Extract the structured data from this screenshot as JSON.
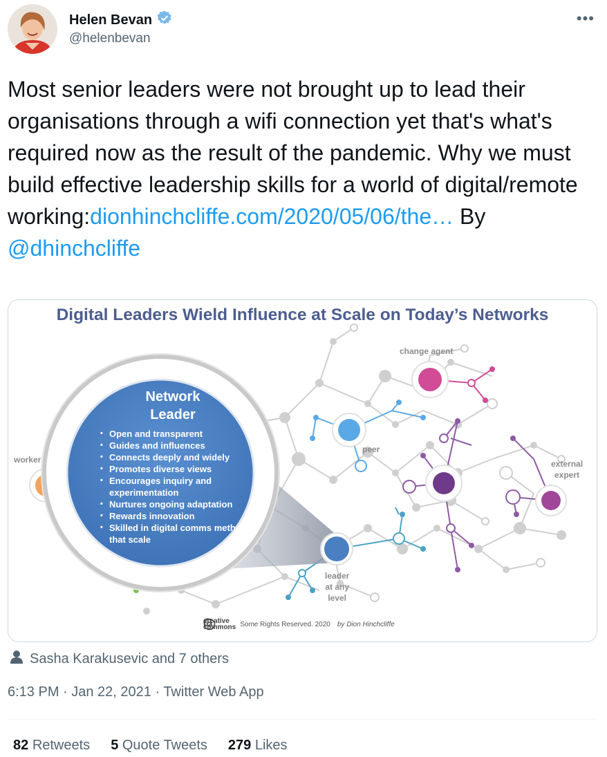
{
  "author": {
    "name": "Helen Bevan",
    "handle": "@helenbevan",
    "verified_icon": "verified-badge-icon",
    "more_icon": "more-horizontal-icon"
  },
  "tweet": {
    "text": "Most senior leaders were not brought up to lead their organisations through a wifi connection yet that's what's required now as the result of the pandemic. Why we must build effective leadership skills for a world of digital/remote working:",
    "link": "dionhinchcliffe.com/2020/05/06/the…",
    "by": " By ",
    "mention": "@dhinchcliffe"
  },
  "media": {
    "title": "Digital Leaders Wield Influence at Scale on Today’s Networks",
    "leader_heading_1": "Network",
    "leader_heading_2": "Leader",
    "traits": [
      "Open and transparent",
      "Guides and influences",
      "Connects deeply and widely",
      "Promotes diverse views",
      "Encourages inquiry and experimentation",
      "Nurtures ongoing adaptation",
      "Rewards innovation",
      "Skilled in digital comms methods that scale"
    ],
    "labels": {
      "worker": "worker",
      "change_agent": "change agent",
      "peer": "peer",
      "external_1": "external",
      "external_2": "expert",
      "leader_1": "leader",
      "leader_2": "at any",
      "leader_3": "level"
    },
    "credit": {
      "cc_1": "creative",
      "cc_2": "commons",
      "rights": "Some Rights Reserved. 2020",
      "author": "by Dion Hinchcliffe"
    },
    "colors": {
      "leader_blue": "#4a80c2",
      "peer_blue": "#5aa9e6",
      "change_pink": "#d14b96",
      "purple": "#6f3a8a",
      "orange": "#f0a35a",
      "green": "#7cbf4d"
    }
  },
  "engagement": {
    "likers_icon": "person-icon",
    "likers": "Sasha Karakusevic and 7 others",
    "timestamp": "6:13 PM · Jan 22, 2021 · Twitter Web App",
    "retweets_count": "82",
    "retweets_label": "Retweets",
    "quotes_count": "5",
    "quotes_label": "Quote Tweets",
    "likes_count": "279",
    "likes_label": "Likes"
  }
}
